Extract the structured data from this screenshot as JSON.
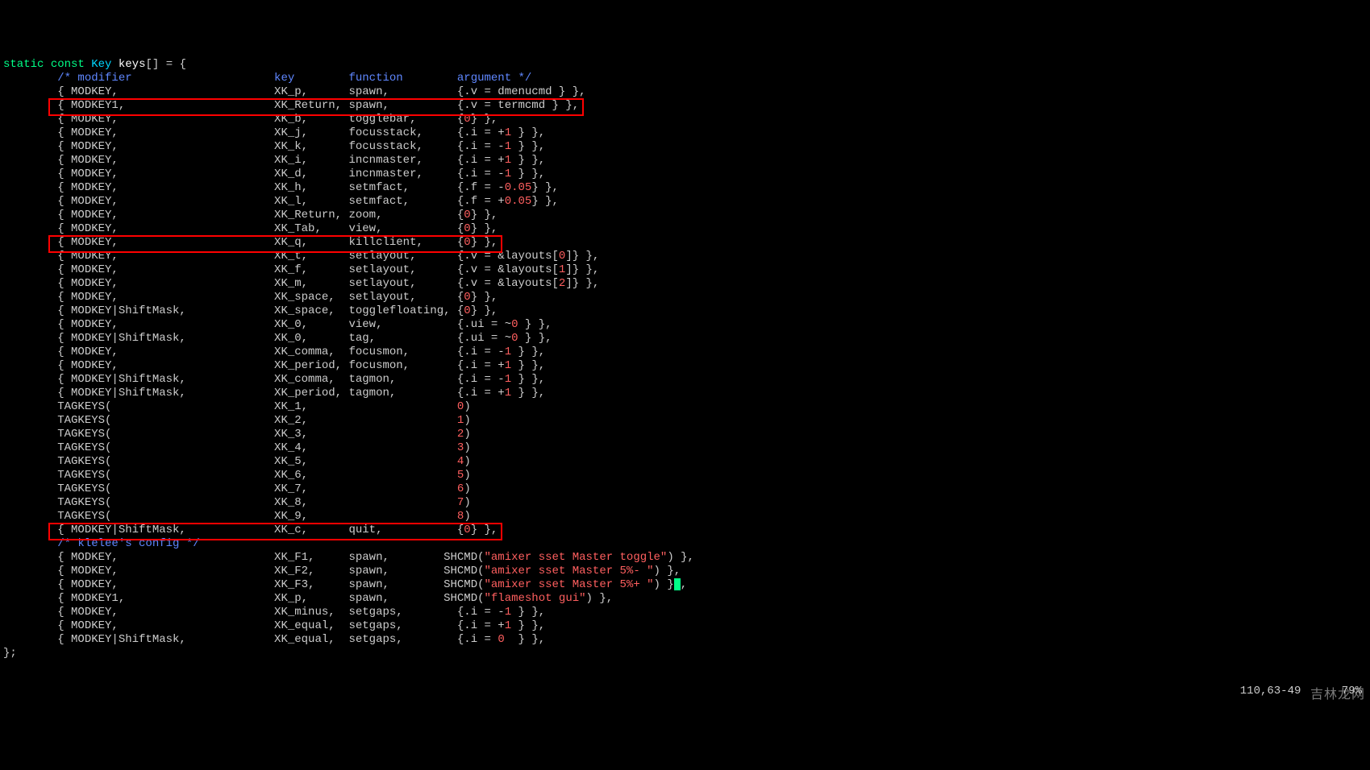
{
  "header": {
    "kw1": "static",
    "kw2": "const",
    "type": "Key",
    "var": "keys",
    "after": "[] = {"
  },
  "comment_header": "        /* modifier                     key        function        argument */",
  "lines": [
    {
      "pre": "        { MODKEY,                       XK_p,      spawn,          {.v = dmenucmd } },",
      "box": false
    },
    {
      "pre": "        { MODKEY1,                      XK_Return, spawn,          {.v = termcmd } },",
      "box": true
    },
    {
      "pre": "        { MODKEY,                       XK_b,      togglebar,      {",
      "num": "0",
      "post": "} },"
    },
    {
      "pre": "        { MODKEY,                       XK_j,      focusstack,     {.i = +",
      "num": "1",
      "post": " } },"
    },
    {
      "pre": "        { MODKEY,                       XK_k,      focusstack,     {.i = -",
      "num": "1",
      "post": " } },"
    },
    {
      "pre": "        { MODKEY,                       XK_i,      incnmaster,     {.i = +",
      "num": "1",
      "post": " } },"
    },
    {
      "pre": "        { MODKEY,                       XK_d,      incnmaster,     {.i = -",
      "num": "1",
      "post": " } },"
    },
    {
      "pre": "        { MODKEY,                       XK_h,      setmfact,       {.f = -",
      "num": "0.05",
      "post": "} },"
    },
    {
      "pre": "        { MODKEY,                       XK_l,      setmfact,       {.f = +",
      "num": "0.05",
      "post": "} },"
    },
    {
      "pre": "        { MODKEY,                       XK_Return, zoom,           {",
      "num": "0",
      "post": "} },"
    },
    {
      "pre": "        { MODKEY,                       XK_Tab,    view,           {",
      "num": "0",
      "post": "} },"
    },
    {
      "pre": "        { MODKEY,                       XK_q,      killclient,     {",
      "num": "0",
      "post": "} },",
      "box": true
    },
    {
      "pre": "        { MODKEY,                       XK_t,      setlayout,      {.v = &layouts[",
      "num": "0",
      "post": "]} },"
    },
    {
      "pre": "        { MODKEY,                       XK_f,      setlayout,      {.v = &layouts[",
      "num": "1",
      "post": "]} },"
    },
    {
      "pre": "        { MODKEY,                       XK_m,      setlayout,      {.v = &layouts[",
      "num": "2",
      "post": "]} },"
    },
    {
      "pre": "        { MODKEY,                       XK_space,  setlayout,      {",
      "num": "0",
      "post": "} },"
    },
    {
      "pre": "        { MODKEY|ShiftMask,             XK_space,  togglefloating, {",
      "num": "0",
      "post": "} },"
    },
    {
      "pre": "        { MODKEY,                       XK_0,      view,           {.ui = ~",
      "num": "0",
      "post": " } },"
    },
    {
      "pre": "        { MODKEY|ShiftMask,             XK_0,      tag,            {.ui = ~",
      "num": "0",
      "post": " } },"
    },
    {
      "pre": "        { MODKEY,                       XK_comma,  focusmon,       {.i = -",
      "num": "1",
      "post": " } },"
    },
    {
      "pre": "        { MODKEY,                       XK_period, focusmon,       {.i = +",
      "num": "1",
      "post": " } },"
    },
    {
      "pre": "        { MODKEY|ShiftMask,             XK_comma,  tagmon,         {.i = -",
      "num": "1",
      "post": " } },"
    },
    {
      "pre": "        { MODKEY|ShiftMask,             XK_period, tagmon,         {.i = +",
      "num": "1",
      "post": " } },"
    },
    {
      "pre": "        TAGKEYS(                        XK_1,                      ",
      "num": "0",
      "post": ")"
    },
    {
      "pre": "        TAGKEYS(                        XK_2,                      ",
      "num": "1",
      "post": ")"
    },
    {
      "pre": "        TAGKEYS(                        XK_3,                      ",
      "num": "2",
      "post": ")"
    },
    {
      "pre": "        TAGKEYS(                        XK_4,                      ",
      "num": "3",
      "post": ")"
    },
    {
      "pre": "        TAGKEYS(                        XK_5,                      ",
      "num": "4",
      "post": ")"
    },
    {
      "pre": "        TAGKEYS(                        XK_6,                      ",
      "num": "5",
      "post": ")"
    },
    {
      "pre": "        TAGKEYS(                        XK_7,                      ",
      "num": "6",
      "post": ")"
    },
    {
      "pre": "        TAGKEYS(                        XK_8,                      ",
      "num": "7",
      "post": ")"
    },
    {
      "pre": "        TAGKEYS(                        XK_9,                      ",
      "num": "8",
      "post": ")"
    },
    {
      "pre": "        { MODKEY|ShiftMask,             XK_c,      quit,           {",
      "num": "0",
      "post": "} },",
      "box": true
    },
    {
      "comment": "        /* klelee's config */"
    },
    {
      "pre": "        { MODKEY,                       XK_F1,     spawn,        SHCMD(",
      "str": "\"amixer sset Master toggle\"",
      "post": ") },"
    },
    {
      "pre": "        { MODKEY,                       XK_F2,     spawn,        SHCMD(",
      "str": "\"amixer sset Master 5%- \"",
      "post": ") },"
    },
    {
      "pre": "        { MODKEY,                       XK_F3,     spawn,        SHCMD(",
      "str": "\"amixer sset Master 5%+ \"",
      "post": ") }",
      "cursor": true,
      "post2": ","
    },
    {
      "pre": "        { MODKEY1,                      XK_p,      spawn,        SHCMD(",
      "str": "\"flameshot gui\"",
      "post": ") },"
    },
    {
      "pre": "        { MODKEY,                       XK_minus,  setgaps,        {.i = -",
      "num": "1",
      "post": " } },"
    },
    {
      "pre": "        { MODKEY,                       XK_equal,  setgaps,        {.i = +",
      "num": "1",
      "post": " } },"
    },
    {
      "pre": "        { MODKEY|ShiftMask,             XK_equal,  setgaps,        {.i = ",
      "num": "0",
      "post": "  } },"
    }
  ],
  "footer": "};",
  "status": "110,63-49      79%",
  "watermark": "吉林龙网"
}
